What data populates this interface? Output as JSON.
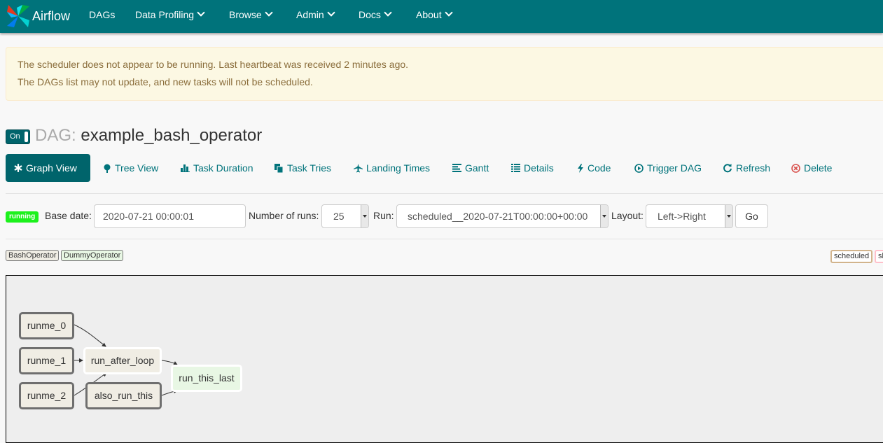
{
  "navbar": {
    "brand": "Airflow",
    "items": [
      {
        "label": "DAGs",
        "dropdown": false
      },
      {
        "label": "Data Profiling",
        "dropdown": true
      },
      {
        "label": "Browse",
        "dropdown": true
      },
      {
        "label": "Admin",
        "dropdown": true
      },
      {
        "label": "Docs",
        "dropdown": true
      },
      {
        "label": "About",
        "dropdown": true
      }
    ],
    "color": "#00737b"
  },
  "alert": {
    "line1": "The scheduler does not appear to be running. Last heartbeat was received 2 minutes ago.",
    "line2": "The DAGs list may not update, and new tasks will not be scheduled."
  },
  "dag": {
    "toggle": "On",
    "prefix": "DAG:",
    "name": "example_bash_operator"
  },
  "tabs": [
    {
      "label": "Graph View",
      "icon": "asterisk-icon",
      "active": true
    },
    {
      "label": "Tree View",
      "icon": "tree-icon"
    },
    {
      "label": "Task Duration",
      "icon": "bar-chart-icon"
    },
    {
      "label": "Task Tries",
      "icon": "duplicate-icon"
    },
    {
      "label": "Landing Times",
      "icon": "plane-icon"
    },
    {
      "label": "Gantt",
      "icon": "align-left-icon"
    },
    {
      "label": "Details",
      "icon": "list-icon"
    },
    {
      "label": "Code",
      "icon": "flash-icon"
    },
    {
      "label": "Trigger DAG",
      "icon": "play-circle-icon"
    },
    {
      "label": "Refresh",
      "icon": "refresh-icon"
    },
    {
      "label": "Delete",
      "icon": "remove-circle-icon"
    }
  ],
  "controls": {
    "status_badge": "running",
    "base_date_label": "Base date:",
    "base_date_value": "2020-07-21 00:00:01",
    "num_runs_label": "Number of runs:",
    "num_runs_value": "25",
    "run_label": "Run:",
    "run_value": "scheduled__2020-07-21T00:00:00+00:00",
    "layout_label": "Layout:",
    "layout_value": "Left->Right",
    "go_label": "Go"
  },
  "legend": {
    "operators": [
      {
        "label": "BashOperator",
        "color": "#f0ede4"
      },
      {
        "label": "DummyOperator",
        "color": "#e8f7e4"
      }
    ],
    "states": [
      {
        "label": "scheduled",
        "color": "#d2b48c"
      },
      {
        "label": "sk",
        "color": "#ffc0cb"
      }
    ]
  },
  "graph": {
    "nodes": [
      {
        "id": "runme_0",
        "label": "runme_0",
        "operator": "BashOperator"
      },
      {
        "id": "runme_1",
        "label": "runme_1",
        "operator": "BashOperator"
      },
      {
        "id": "runme_2",
        "label": "runme_2",
        "operator": "BashOperator"
      },
      {
        "id": "run_after_loop",
        "label": "run_after_loop",
        "operator": "BashOperator"
      },
      {
        "id": "also_run_this",
        "label": "also_run_this",
        "operator": "BashOperator"
      },
      {
        "id": "run_this_last",
        "label": "run_this_last",
        "operator": "DummyOperator"
      }
    ],
    "edges": [
      [
        "runme_0",
        "run_after_loop"
      ],
      [
        "runme_1",
        "run_after_loop"
      ],
      [
        "runme_2",
        "run_after_loop"
      ],
      [
        "run_after_loop",
        "run_this_last"
      ],
      [
        "also_run_this",
        "run_this_last"
      ]
    ]
  }
}
